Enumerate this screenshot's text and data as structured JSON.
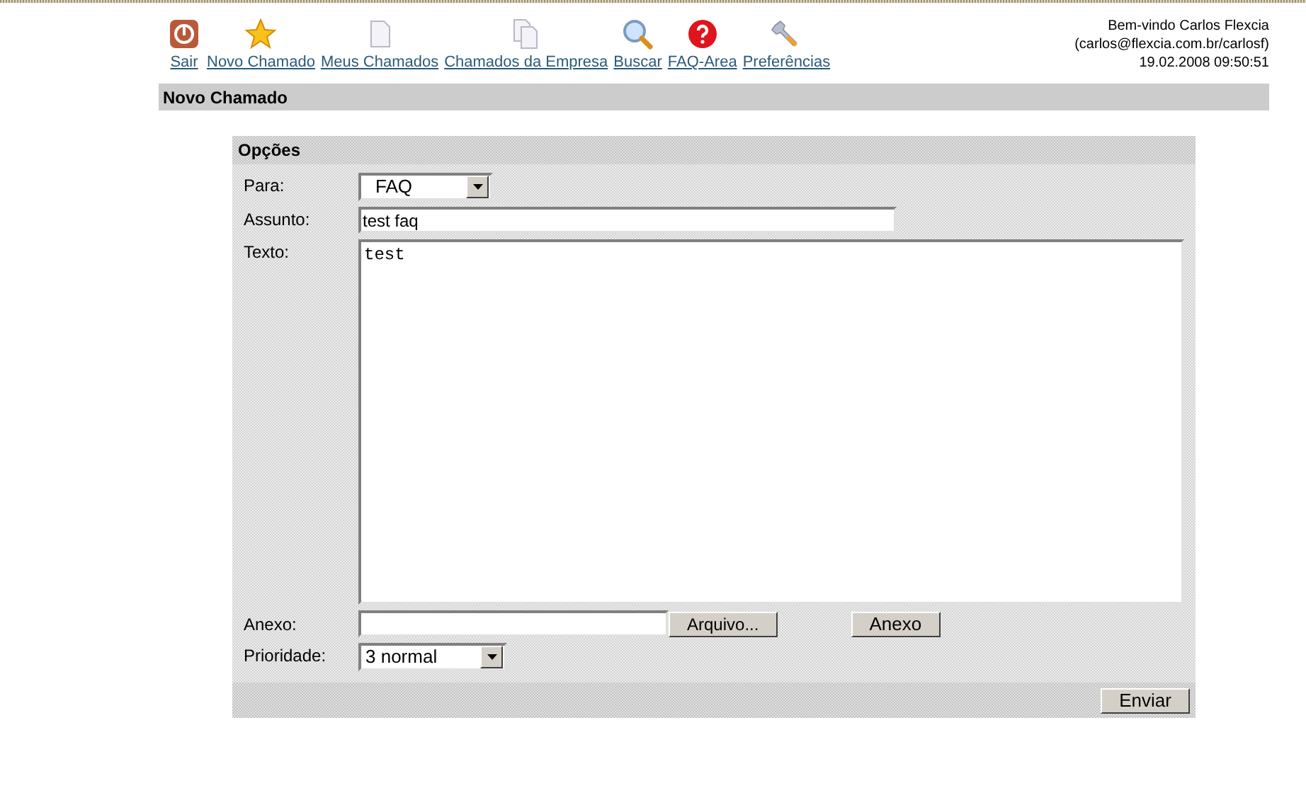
{
  "nav": [
    {
      "label": "Sair",
      "kind": "power"
    },
    {
      "label": "Novo Chamado",
      "kind": "star"
    },
    {
      "label": "Meus Chamados",
      "kind": "document"
    },
    {
      "label": "Chamados da Empresa",
      "kind": "documents"
    },
    {
      "label": "Buscar",
      "kind": "search"
    },
    {
      "label": "FAQ-Area",
      "kind": "help"
    },
    {
      "label": "Preferências",
      "kind": "wrench"
    }
  ],
  "user": {
    "welcome": "Bem-vindo Carlos Flexcia",
    "account": "(carlos@flexcia.com.br/carlosf)",
    "datetime": "19.02.2008 09:50:51"
  },
  "page_title": "Novo Chamado",
  "form": {
    "title": "Opções",
    "para": {
      "label": "Para:",
      "value": "FAQ"
    },
    "assunto": {
      "label": "Assunto:",
      "value": "test faq"
    },
    "texto": {
      "label": "Texto:",
      "value": "test"
    },
    "anexo": {
      "label": "Anexo:",
      "browse_button": "Arquivo...",
      "attach_button": "Anexo"
    },
    "prioridade": {
      "label": "Prioridade:",
      "value": "3 normal"
    },
    "submit": "Enviar"
  }
}
